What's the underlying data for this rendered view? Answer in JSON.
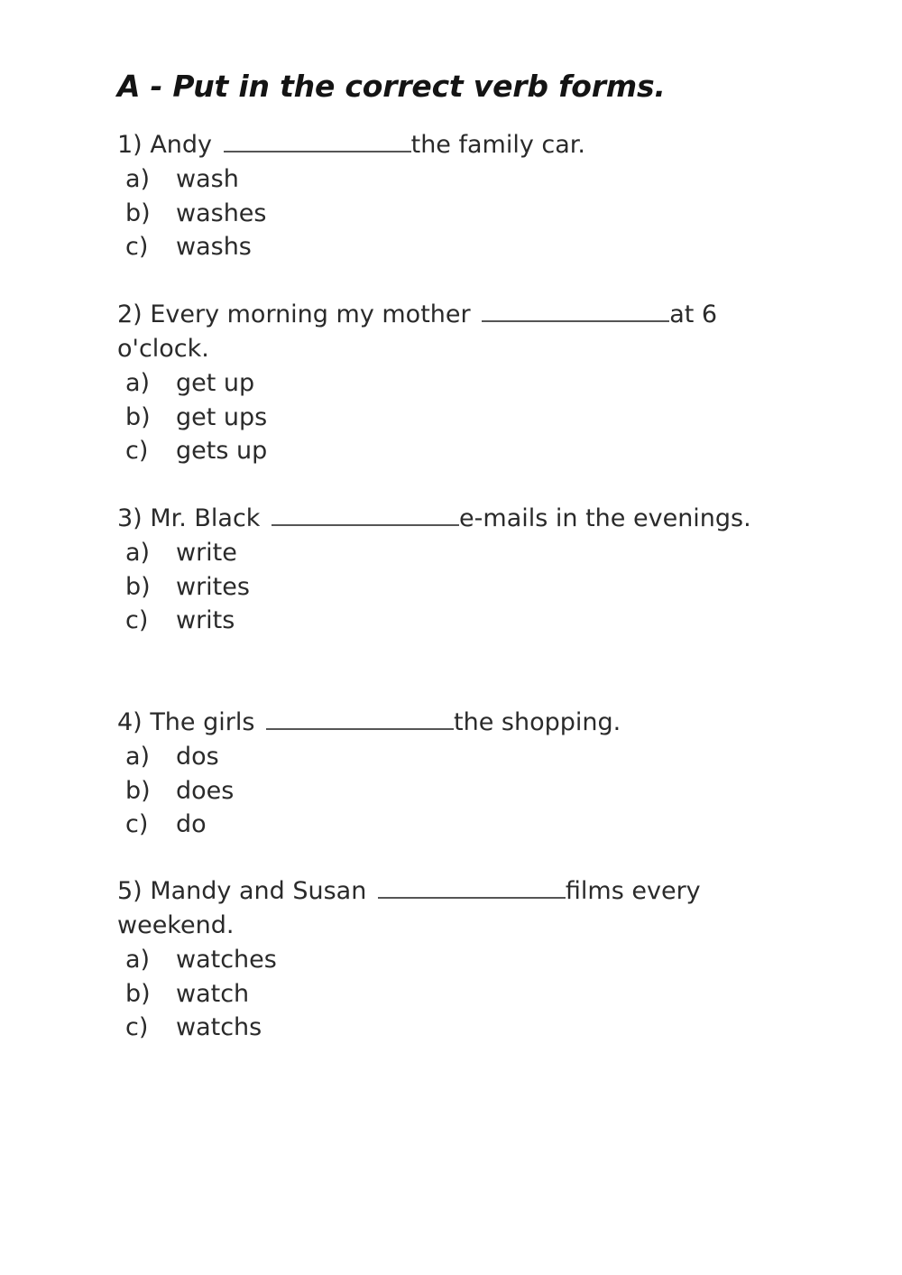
{
  "worksheet": {
    "title": "A - Put in the correct verb forms.",
    "questions": [
      {
        "number": "1)",
        "before": "Andy",
        "after": "the family car.",
        "options": [
          {
            "letter": "a)",
            "text": "wash"
          },
          {
            "letter": "b)",
            "text": "washes"
          },
          {
            "letter": "c)",
            "text": "washs"
          }
        ]
      },
      {
        "number": "2)",
        "before": "Every morning my mother",
        "after": "at 6 o'clock.",
        "options": [
          {
            "letter": "a)",
            "text": "get up"
          },
          {
            "letter": "b)",
            "text": "get ups"
          },
          {
            "letter": "c)",
            "text": "gets up"
          }
        ]
      },
      {
        "number": "3)",
        "before": "Mr. Black",
        "after": "e-mails in the evenings.",
        "options": [
          {
            "letter": "a)",
            "text": "write"
          },
          {
            "letter": "b)",
            "text": "writes"
          },
          {
            "letter": "c)",
            "text": "writs"
          }
        ]
      },
      {
        "number": "4)",
        "before": "The girls",
        "after": "the shopping.",
        "options": [
          {
            "letter": "a)",
            "text": "dos"
          },
          {
            "letter": "b)",
            "text": "does"
          },
          {
            "letter": "c)",
            "text": "do"
          }
        ]
      },
      {
        "number": "5)",
        "before": "Mandy and Susan",
        "after": "films every weekend.",
        "options": [
          {
            "letter": "a)",
            "text": "watches"
          },
          {
            "letter": "b)",
            "text": "watch"
          },
          {
            "letter": "c)",
            "text": "watchs"
          }
        ]
      }
    ]
  }
}
